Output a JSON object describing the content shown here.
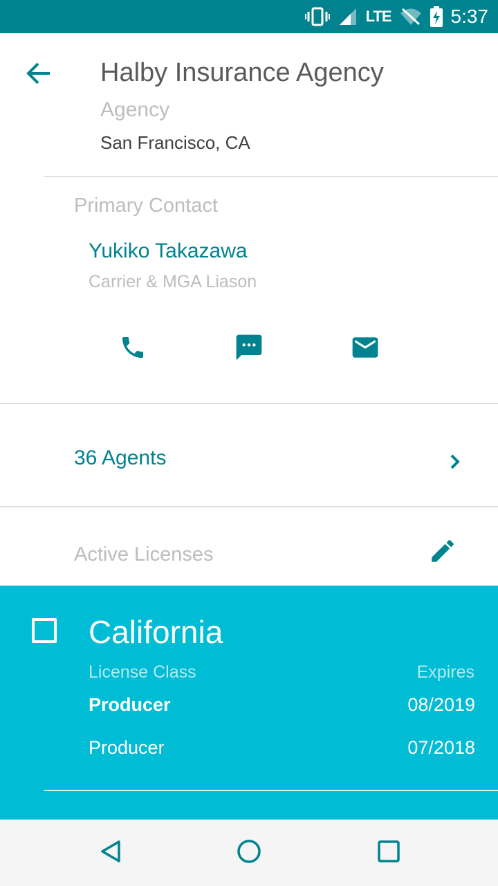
{
  "status_bar": {
    "network": "LTE",
    "time": "5:37",
    "icons": [
      "vibrate-icon",
      "signal-icon",
      "wifi-off-icon",
      "battery-charging-icon"
    ]
  },
  "header": {
    "back_icon": "arrow-left-icon",
    "title": "Halby Insurance Agency",
    "type": "Agency",
    "location": "San Francisco, CA"
  },
  "primary_contact": {
    "section_label": "Primary Contact",
    "name": "Yukiko Takazawa",
    "role": "Carrier & MGA Liason",
    "actions": [
      "phone-icon",
      "message-icon",
      "email-icon"
    ]
  },
  "agents": {
    "label": "36 Agents",
    "icon": "chevron-right-icon"
  },
  "licenses": {
    "section_label": "Active Licenses",
    "edit_icon": "pencil-icon",
    "state": "California",
    "checked": false,
    "col_class": "License Class",
    "col_expires": "Expires",
    "rows": [
      {
        "class": "Producer",
        "expires": "08/2019"
      },
      {
        "class": "Producer",
        "expires": "07/2018"
      }
    ]
  },
  "colors": {
    "primary_dark": "#00838f",
    "accent": "#00bcd4",
    "muted_text": "#bdbdbd"
  },
  "nav_bar": {
    "icons": [
      "back-triangle-icon",
      "home-circle-icon",
      "recents-square-icon"
    ]
  }
}
